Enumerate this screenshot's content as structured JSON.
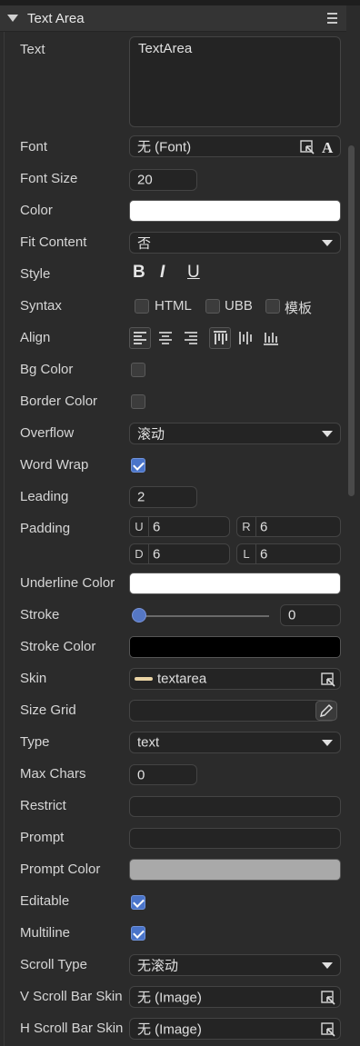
{
  "panel": {
    "title": "Text Area"
  },
  "labels": {
    "text": "Text",
    "font": "Font",
    "font_size": "Font Size",
    "color": "Color",
    "fit_content": "Fit Content",
    "style": "Style",
    "syntax": "Syntax",
    "align": "Align",
    "bg_color": "Bg Color",
    "border_color": "Border Color",
    "overflow": "Overflow",
    "word_wrap": "Word Wrap",
    "leading": "Leading",
    "padding": "Padding",
    "underline_color": "Underline Color",
    "stroke": "Stroke",
    "stroke_color": "Stroke Color",
    "skin": "Skin",
    "size_grid": "Size Grid",
    "type": "Type",
    "max_chars": "Max Chars",
    "restrict": "Restrict",
    "prompt": "Prompt",
    "prompt_color": "Prompt Color",
    "editable": "Editable",
    "multiline": "Multiline",
    "scroll_type": "Scroll Type",
    "v_scroll_bar_skin": "V Scroll Bar Skin",
    "h_scroll_bar_skin": "H Scroll Bar Skin"
  },
  "values": {
    "text": "TextArea",
    "font": "无 (Font)",
    "font_size": "20",
    "color": "#ffffff",
    "fit_content": "否",
    "style_buttons": [
      "B",
      "I",
      "U"
    ],
    "syntax": [
      {
        "label": "HTML",
        "checked": false
      },
      {
        "label": "UBB",
        "checked": false
      },
      {
        "label": "模板",
        "checked": false
      }
    ],
    "bg_color_checked": false,
    "border_color_checked": false,
    "overflow": "滚动",
    "word_wrap": true,
    "leading": "2",
    "padding": {
      "U": "6",
      "R": "6",
      "D": "6",
      "L": "6"
    },
    "underline_color": "#ffffff",
    "stroke": "0",
    "stroke_slider": 0,
    "stroke_color": "#000000",
    "skin": "textarea",
    "size_grid": "",
    "type": "text",
    "max_chars": "0",
    "restrict": "",
    "prompt": "",
    "prompt_color": "#a9a9a9",
    "editable": true,
    "multiline": true,
    "scroll_type": "无滚动",
    "v_scroll_bar_skin": "无 (Image)",
    "h_scroll_bar_skin": "无 (Image)"
  },
  "padding_tags": {
    "u": "U",
    "r": "R",
    "d": "D",
    "l": "L"
  },
  "icons": {
    "panel_menu": "hamburger-icon",
    "font_pick": "select-arrow-icon",
    "font_resource": "font-a-icon",
    "size_grid_edit": "pencil-icon",
    "skin_color": "#e9d3a4"
  }
}
